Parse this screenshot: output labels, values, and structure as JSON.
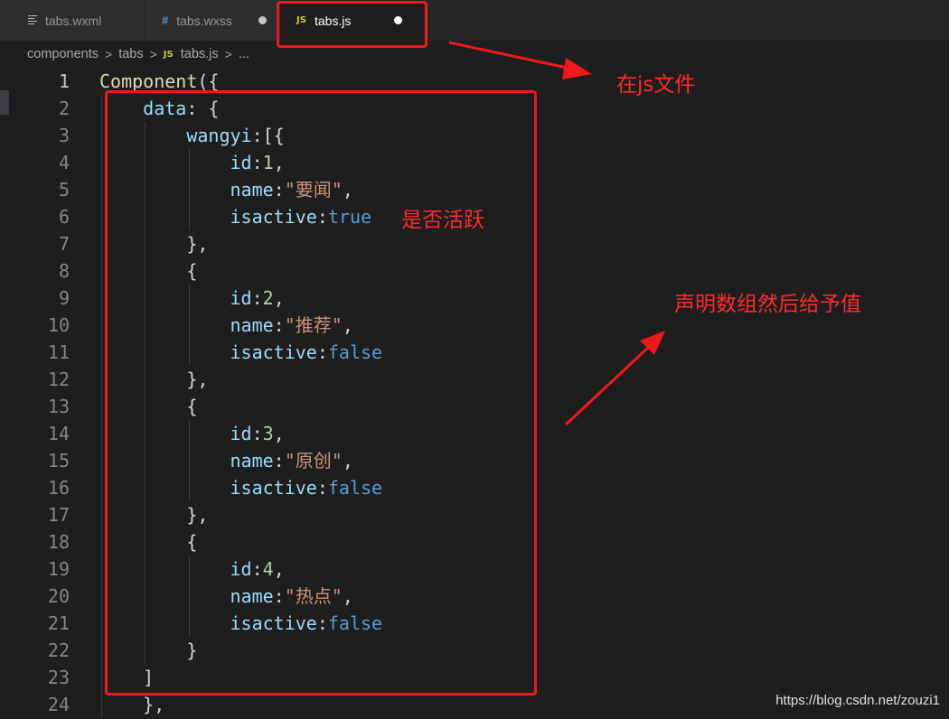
{
  "tabs": [
    {
      "label": "tabs.wxml",
      "icon": "file-lines-icon",
      "active": false,
      "dirty": false
    },
    {
      "label": "tabs.wxss",
      "icon": "hash-icon",
      "active": false,
      "dirty": true
    },
    {
      "label": "tabs.js",
      "icon": "js-icon",
      "active": true,
      "dirty": true
    }
  ],
  "tab_icons": {
    "hash": "#",
    "js": "JS"
  },
  "breadcrumb": {
    "items": [
      "components",
      "tabs",
      "tabs.js",
      "..."
    ],
    "separator": ">",
    "js_icon": "JS"
  },
  "editor": {
    "current_line": 1,
    "lines": [
      {
        "n": "1",
        "tokens": [
          {
            "t": "Component",
            "c": "func"
          },
          {
            "t": "({",
            "c": "plain"
          }
        ]
      },
      {
        "n": "2",
        "tokens": [
          {
            "t": "    ",
            "c": "plain"
          },
          {
            "t": "data",
            "c": "prop"
          },
          {
            "t": ": {",
            "c": "plain"
          }
        ]
      },
      {
        "n": "3",
        "tokens": [
          {
            "t": "        ",
            "c": "plain"
          },
          {
            "t": "wangyi",
            "c": "prop"
          },
          {
            "t": ":[{",
            "c": "plain"
          }
        ]
      },
      {
        "n": "4",
        "tokens": [
          {
            "t": "            ",
            "c": "plain"
          },
          {
            "t": "id",
            "c": "prop"
          },
          {
            "t": ":",
            "c": "plain"
          },
          {
            "t": "1",
            "c": "num"
          },
          {
            "t": ",",
            "c": "plain"
          }
        ]
      },
      {
        "n": "5",
        "tokens": [
          {
            "t": "            ",
            "c": "plain"
          },
          {
            "t": "name",
            "c": "prop"
          },
          {
            "t": ":",
            "c": "plain"
          },
          {
            "t": "\"要闻\"",
            "c": "str"
          },
          {
            "t": ",",
            "c": "plain"
          }
        ]
      },
      {
        "n": "6",
        "tokens": [
          {
            "t": "            ",
            "c": "plain"
          },
          {
            "t": "isactive",
            "c": "prop"
          },
          {
            "t": ":",
            "c": "plain"
          },
          {
            "t": "true",
            "c": "bool"
          }
        ]
      },
      {
        "n": "7",
        "tokens": [
          {
            "t": "        },",
            "c": "plain"
          }
        ]
      },
      {
        "n": "8",
        "tokens": [
          {
            "t": "        {",
            "c": "plain"
          }
        ]
      },
      {
        "n": "9",
        "tokens": [
          {
            "t": "            ",
            "c": "plain"
          },
          {
            "t": "id",
            "c": "prop"
          },
          {
            "t": ":",
            "c": "plain"
          },
          {
            "t": "2",
            "c": "num"
          },
          {
            "t": ",",
            "c": "plain"
          }
        ]
      },
      {
        "n": "10",
        "tokens": [
          {
            "t": "            ",
            "c": "plain"
          },
          {
            "t": "name",
            "c": "prop"
          },
          {
            "t": ":",
            "c": "plain"
          },
          {
            "t": "\"推荐\"",
            "c": "str"
          },
          {
            "t": ",",
            "c": "plain"
          }
        ]
      },
      {
        "n": "11",
        "tokens": [
          {
            "t": "            ",
            "c": "plain"
          },
          {
            "t": "isactive",
            "c": "prop"
          },
          {
            "t": ":",
            "c": "plain"
          },
          {
            "t": "false",
            "c": "bool"
          }
        ]
      },
      {
        "n": "12",
        "tokens": [
          {
            "t": "        },",
            "c": "plain"
          }
        ]
      },
      {
        "n": "13",
        "tokens": [
          {
            "t": "        {",
            "c": "plain"
          }
        ]
      },
      {
        "n": "14",
        "tokens": [
          {
            "t": "            ",
            "c": "plain"
          },
          {
            "t": "id",
            "c": "prop"
          },
          {
            "t": ":",
            "c": "plain"
          },
          {
            "t": "3",
            "c": "num"
          },
          {
            "t": ",",
            "c": "plain"
          }
        ]
      },
      {
        "n": "15",
        "tokens": [
          {
            "t": "            ",
            "c": "plain"
          },
          {
            "t": "name",
            "c": "prop"
          },
          {
            "t": ":",
            "c": "plain"
          },
          {
            "t": "\"原创\"",
            "c": "str"
          },
          {
            "t": ",",
            "c": "plain"
          }
        ]
      },
      {
        "n": "16",
        "tokens": [
          {
            "t": "            ",
            "c": "plain"
          },
          {
            "t": "isactive",
            "c": "prop"
          },
          {
            "t": ":",
            "c": "plain"
          },
          {
            "t": "false",
            "c": "bool"
          }
        ]
      },
      {
        "n": "17",
        "tokens": [
          {
            "t": "        },",
            "c": "plain"
          }
        ]
      },
      {
        "n": "18",
        "tokens": [
          {
            "t": "        {",
            "c": "plain"
          }
        ]
      },
      {
        "n": "19",
        "tokens": [
          {
            "t": "            ",
            "c": "plain"
          },
          {
            "t": "id",
            "c": "prop"
          },
          {
            "t": ":",
            "c": "plain"
          },
          {
            "t": "4",
            "c": "num"
          },
          {
            "t": ",",
            "c": "plain"
          }
        ]
      },
      {
        "n": "20",
        "tokens": [
          {
            "t": "            ",
            "c": "plain"
          },
          {
            "t": "name",
            "c": "prop"
          },
          {
            "t": ":",
            "c": "plain"
          },
          {
            "t": "\"热点\"",
            "c": "str"
          },
          {
            "t": ",",
            "c": "plain"
          }
        ]
      },
      {
        "n": "21",
        "tokens": [
          {
            "t": "            ",
            "c": "plain"
          },
          {
            "t": "isactive",
            "c": "prop"
          },
          {
            "t": ":",
            "c": "plain"
          },
          {
            "t": "false",
            "c": "bool"
          }
        ]
      },
      {
        "n": "22",
        "tokens": [
          {
            "t": "        }",
            "c": "plain"
          }
        ]
      },
      {
        "n": "23",
        "tokens": [
          {
            "t": "    ]",
            "c": "plain"
          }
        ]
      },
      {
        "n": "24",
        "tokens": [
          {
            "t": "    },",
            "c": "plain"
          }
        ]
      }
    ]
  },
  "annotations": {
    "js_file_note": "在js文件",
    "isactive_note": "是否活跃",
    "array_note": "声明数组然后给予值"
  },
  "colors": {
    "annotation_red": "#ee1a1a",
    "editor_bg": "#1e1e1e"
  },
  "watermark": "https://blog.csdn.net/zouzi1"
}
